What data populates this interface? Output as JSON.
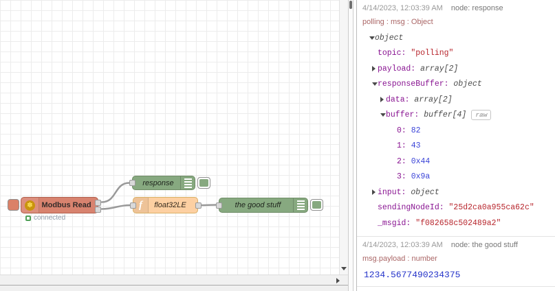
{
  "canvas": {
    "nodes": {
      "modbus": {
        "label": "Modbus Read",
        "status": "connected",
        "icon": "modbus-flower-icon"
      },
      "response": {
        "label": "response"
      },
      "function": {
        "label": "float32LE",
        "icon": "f"
      },
      "good_stuff": {
        "label": "the good stuff"
      }
    },
    "colors": {
      "modbus_node": "#d8836f",
      "debug_node": "#87a980",
      "function_node": "#fdd0a2",
      "wire": "#999999",
      "status_green": "#4f9f57",
      "grid_line": "#ececec"
    }
  },
  "debug": {
    "colors": {
      "subject": "#aa6666",
      "key": "#881391",
      "string": "#b7252c",
      "number": "#3b44d8",
      "type": "#4a4a4a"
    },
    "messages": [
      {
        "timestamp": "4/14/2023, 12:03:39 AM",
        "node": "node: response",
        "subject": "polling : msg : Object",
        "tree": [
          {
            "indent": 1,
            "arrow": "down",
            "value": "object",
            "vclass": "type"
          },
          {
            "indent": 2,
            "key": "topic",
            "value": "\"polling\"",
            "vclass": "string"
          },
          {
            "indent": 2,
            "arrow": "right",
            "key": "payload",
            "value": "array[2]",
            "vclass": "type"
          },
          {
            "indent": 2,
            "arrow": "down",
            "key": "responseBuffer",
            "value": "object",
            "vclass": "type"
          },
          {
            "indent": 3,
            "arrow": "right",
            "key": "data",
            "value": "array[2]",
            "vclass": "type"
          },
          {
            "indent": 3,
            "arrow": "down",
            "key": "buffer",
            "value": "buffer[4]",
            "vclass": "type",
            "raw": "raw"
          },
          {
            "indent": 4,
            "key": "0",
            "value": "82",
            "vclass": "number"
          },
          {
            "indent": 4,
            "key": "1",
            "value": "43",
            "vclass": "number"
          },
          {
            "indent": 4,
            "key": "2",
            "value": "0x44",
            "vclass": "number"
          },
          {
            "indent": 4,
            "key": "3",
            "value": "0x9a",
            "vclass": "number"
          },
          {
            "indent": 2,
            "arrow": "right",
            "key": "input",
            "value": "object",
            "vclass": "type"
          },
          {
            "indent": 2,
            "key": "sendingNodeId",
            "value": "\"25d2ca0a955ca62c\"",
            "vclass": "string"
          },
          {
            "indent": 2,
            "key": "_msgid",
            "value": "\"f082658c502489a2\"",
            "vclass": "string"
          }
        ]
      },
      {
        "timestamp": "4/14/2023, 12:03:39 AM",
        "node": "node: the good stuff",
        "subject": "msg.payload : number",
        "payload": "1234.5677490234375"
      }
    ]
  }
}
